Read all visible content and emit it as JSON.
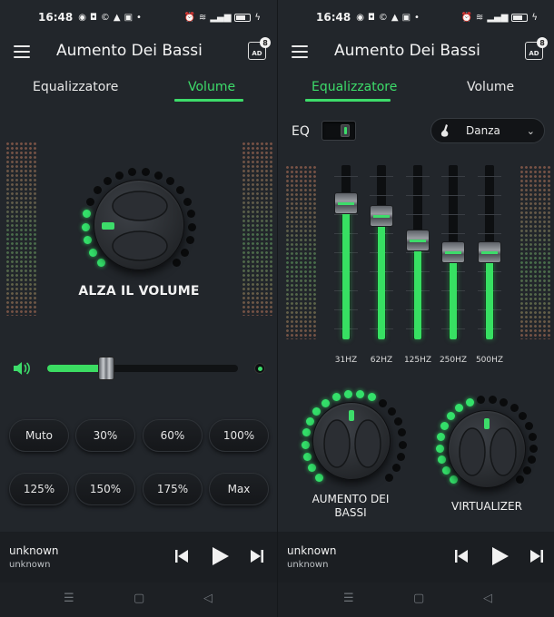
{
  "status": {
    "time": "16:48",
    "left_icons": [
      "whatsapp-icon",
      "messenger-icon",
      "c-icon",
      "twitter-icon",
      "news-icon",
      "dot-icon"
    ],
    "right_icons": [
      "alarm-icon",
      "wifi-icon",
      "signal-icon",
      "battery-icon",
      "charging-icon"
    ]
  },
  "app": {
    "title": "Aumento Dei Bassi",
    "ad_badge": "AD",
    "ad_badge_count": "8"
  },
  "tabs": {
    "equalizer": "Equalizzatore",
    "volume": "Volume"
  },
  "volume_screen": {
    "active_tab": "Volume",
    "knob_caption": "ALZA IL VOLUME",
    "knob_level": 0.25,
    "slider_level": 0.31,
    "presets": [
      "Muto",
      "30%",
      "60%",
      "100%",
      "125%",
      "150%",
      "175%",
      "Max"
    ]
  },
  "eq_screen": {
    "active_tab": "Equalizzatore",
    "eq_label": "EQ",
    "eq_enabled": true,
    "preset_value": "Danza",
    "bands": [
      {
        "freq": "31HZ",
        "level": 0.78
      },
      {
        "freq": "62HZ",
        "level": 0.71
      },
      {
        "freq": "125HZ",
        "level": 0.57
      },
      {
        "freq": "250HZ",
        "level": 0.5
      },
      {
        "freq": "500HZ",
        "level": 0.5
      }
    ],
    "bass_caption": "AUMENTO DEI\nBASSI",
    "bass_caption_line1": "AUMENTO DEI",
    "bass_caption_line2": "BASSI",
    "bass_level": 0.6,
    "virtualizer_caption": "VIRTUALIZER",
    "virtualizer_level": 0.45
  },
  "player": {
    "title": "unknown",
    "artist": "unknown"
  },
  "colors": {
    "accent": "#3ddc6a",
    "background": "#22262b",
    "player_bg": "#1b1e22"
  }
}
